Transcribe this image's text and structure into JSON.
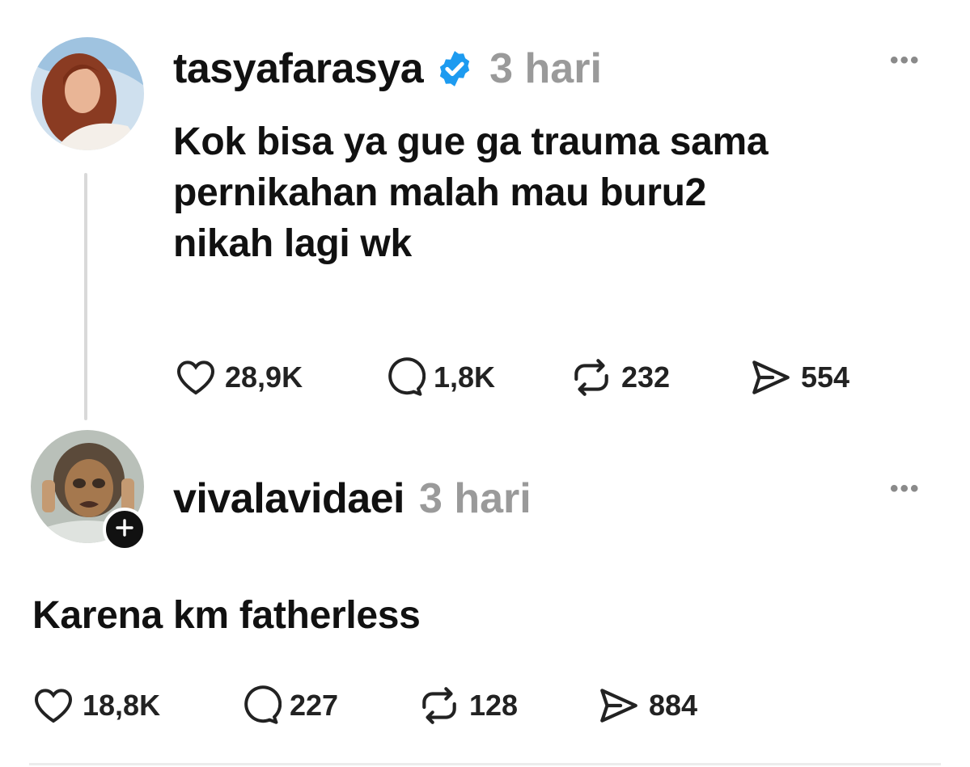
{
  "posts": [
    {
      "username": "tasyafarasya",
      "verified": true,
      "time": "3 hari",
      "text_lines": [
        "Kok bisa ya gue ga trauma sama",
        "pernikahan malah mau buru2",
        "nikah lagi wk"
      ],
      "stats": {
        "likes": "28,9K",
        "replies": "1,8K",
        "reposts": "232",
        "shares": "554"
      }
    },
    {
      "username": "vivalavidaei",
      "verified": false,
      "time": "3 hari",
      "text_lines": [
        "Karena km fatherless"
      ],
      "stats": {
        "likes": "18,8K",
        "replies": "227",
        "reposts": "128",
        "shares": "884"
      }
    }
  ],
  "icons": {
    "like": "heart-icon",
    "reply": "comment-bubble-icon",
    "repost": "repost-icon",
    "share": "share-send-icon",
    "more": "more-options-icon",
    "verified": "verified-badge-icon",
    "follow": "plus-icon"
  },
  "colors": {
    "verified": "#1d9bf0",
    "muted": "#9a9a9a",
    "text": "#111111"
  }
}
